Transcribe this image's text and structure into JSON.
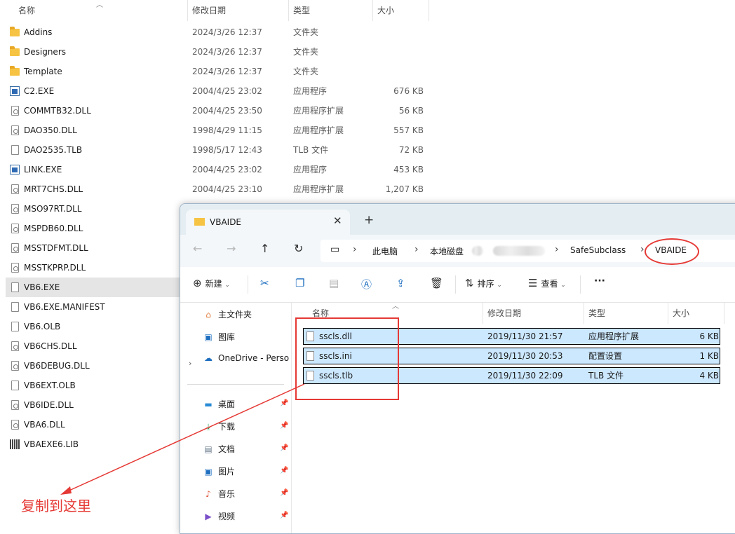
{
  "bg_explorer": {
    "columns": {
      "name": "名称",
      "date": "修改日期",
      "type": "类型",
      "size": "大小"
    },
    "rows": [
      {
        "name": "Addins",
        "date": "2024/3/26 12:37",
        "type": "文件夹",
        "size": "",
        "icon": "folder-icon"
      },
      {
        "name": "Designers",
        "date": "2024/3/26 12:37",
        "type": "文件夹",
        "size": "",
        "icon": "folder-icon"
      },
      {
        "name": "Template",
        "date": "2024/3/26 12:37",
        "type": "文件夹",
        "size": "",
        "icon": "folder-icon"
      },
      {
        "name": "C2.EXE",
        "date": "2004/4/25 23:02",
        "type": "应用程序",
        "size": "676 KB",
        "icon": "exe-icon"
      },
      {
        "name": "COMMTB32.DLL",
        "date": "2004/4/25 23:50",
        "type": "应用程序扩展",
        "size": "56 KB",
        "icon": "dll-icon"
      },
      {
        "name": "DAO350.DLL",
        "date": "1998/4/29 11:15",
        "type": "应用程序扩展",
        "size": "557 KB",
        "icon": "dll-icon"
      },
      {
        "name": "DAO2535.TLB",
        "date": "1998/5/17 12:43",
        "type": "TLB 文件",
        "size": "72 KB",
        "icon": "file-icon"
      },
      {
        "name": "LINK.EXE",
        "date": "2004/4/25 23:02",
        "type": "应用程序",
        "size": "453 KB",
        "icon": "exe-icon"
      },
      {
        "name": "MRT7CHS.DLL",
        "date": "2004/4/25 23:10",
        "type": "应用程序扩展",
        "size": "1,207 KB",
        "icon": "dll-icon"
      },
      {
        "name": "MSO97RT.DLL",
        "date": "",
        "type": "",
        "size": "",
        "icon": "dll-icon"
      },
      {
        "name": "MSPDB60.DLL",
        "date": "",
        "type": "",
        "size": "",
        "icon": "dll-icon"
      },
      {
        "name": "MSSTDFMT.DLL",
        "date": "",
        "type": "",
        "size": "",
        "icon": "dll-icon"
      },
      {
        "name": "MSSTKPRP.DLL",
        "date": "",
        "type": "",
        "size": "",
        "icon": "dll-icon"
      },
      {
        "name": "VB6.EXE",
        "date": "",
        "type": "",
        "size": "",
        "icon": "vb6-exe-icon"
      },
      {
        "name": "VB6.EXE.MANIFEST",
        "date": "",
        "type": "",
        "size": "",
        "icon": "file-icon"
      },
      {
        "name": "VB6.OLB",
        "date": "",
        "type": "",
        "size": "",
        "icon": "file-icon"
      },
      {
        "name": "VB6CHS.DLL",
        "date": "",
        "type": "",
        "size": "",
        "icon": "dll-icon"
      },
      {
        "name": "VB6DEBUG.DLL",
        "date": "",
        "type": "",
        "size": "",
        "icon": "dll-icon"
      },
      {
        "name": "VB6EXT.OLB",
        "date": "",
        "type": "",
        "size": "",
        "icon": "file-icon"
      },
      {
        "name": "VB6IDE.DLL",
        "date": "",
        "type": "",
        "size": "",
        "icon": "dll-icon"
      },
      {
        "name": "VBA6.DLL",
        "date": "",
        "type": "",
        "size": "",
        "icon": "dll-icon"
      },
      {
        "name": "VBAEXE6.LIB",
        "date": "",
        "type": "",
        "size": "",
        "icon": "lib-icon"
      }
    ]
  },
  "window": {
    "tab_title": "VBAIDE",
    "tab_close": "✕",
    "new_tab": "+",
    "breadcrumb": [
      "此电脑",
      "本地磁盘",
      "SafeSubclass",
      "VBAIDE"
    ],
    "toolbar": {
      "new": "新建",
      "sort": "排序",
      "view": "查看",
      "more": "···"
    },
    "nav": {
      "home": "主文件夹",
      "gallery": "图库",
      "onedrive": "OneDrive - Perso",
      "desktop": "桌面",
      "downloads": "下载",
      "documents": "文档",
      "pictures": "图片",
      "music": "音乐",
      "videos": "视频"
    },
    "columns": {
      "name": "名称",
      "date": "修改日期",
      "type": "类型",
      "size": "大小"
    },
    "files": [
      {
        "name": "sscls.dll",
        "date": "2019/11/30 21:57",
        "type": "应用程序扩展",
        "size": "6 KB"
      },
      {
        "name": "sscls.ini",
        "date": "2019/11/30 20:53",
        "type": "配置设置",
        "size": "1 KB"
      },
      {
        "name": "sscls.tlb",
        "date": "2019/11/30 22:09",
        "type": "TLB 文件",
        "size": "4 KB"
      }
    ]
  },
  "annotation": {
    "text": "复制到这里",
    "color": "#e53935"
  }
}
